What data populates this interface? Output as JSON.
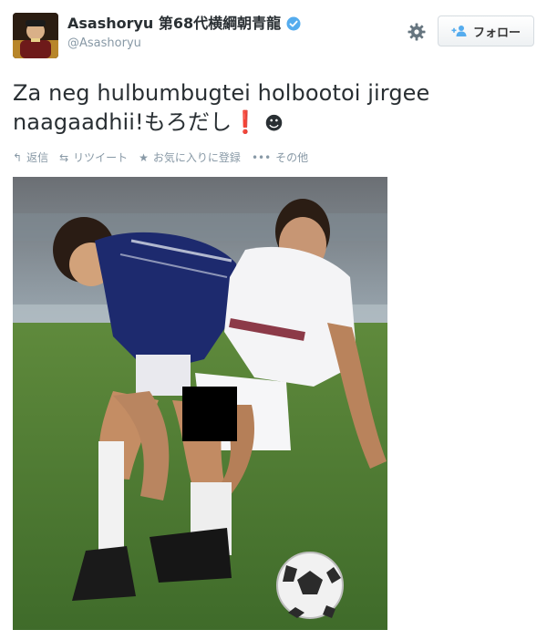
{
  "tweet": {
    "display_name": "Asashoryu 第68代横綱朝青龍",
    "handle": "@Asashoryu",
    "text_line1": "Za neg hulbumbugtei holbootoi jirgee",
    "text_line2": "naagaadhii!もろだし",
    "exclamation": "❗",
    "smiley": "☻",
    "follow_label": "フォロー",
    "actions": [
      {
        "icon": "reply-icon",
        "glyph": "↰",
        "label": "返信"
      },
      {
        "icon": "retweet-icon",
        "glyph": "⇆",
        "label": "リツイート"
      },
      {
        "icon": "star-icon",
        "glyph": "★",
        "label": "お気に入りに登録"
      },
      {
        "icon": "more-icon",
        "glyph": "•••",
        "label": "その他"
      }
    ]
  },
  "colors": {
    "text": "#292f33",
    "muted": "#8899a6",
    "verified": "#55acee",
    "accent_red": "#d0021b"
  },
  "photo": {
    "subject": "soccer-players-photo",
    "censor_box": "black-censor-square"
  }
}
